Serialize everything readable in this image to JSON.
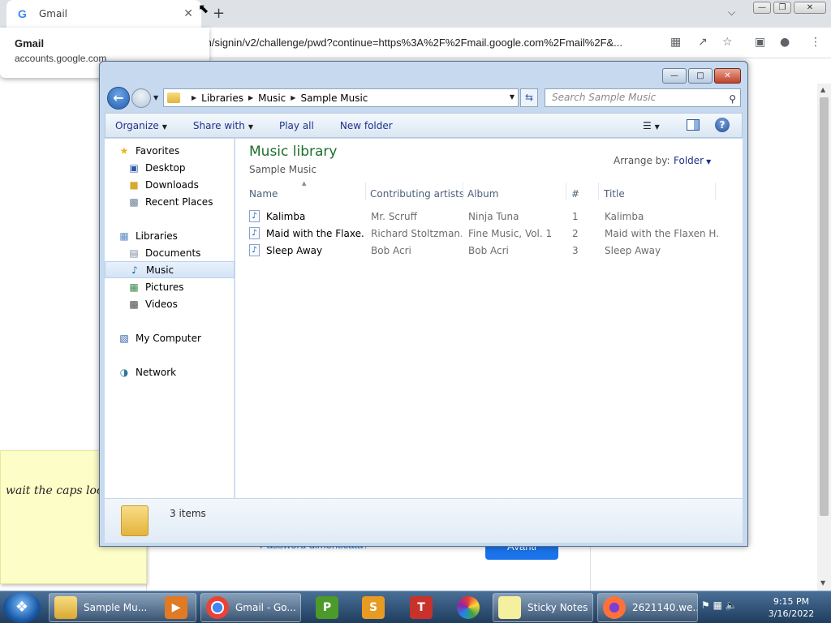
{
  "chrome": {
    "tab_title": "Gmail",
    "tab_icon": "G",
    "close_glyph": "✕",
    "new_tab_glyph": "+",
    "address": "m/signin/v2/challenge/pwd?continue=https%3A%2F%2Fmail.google.com%2Fmail%2F&...",
    "hover_card": {
      "title": "Gmail",
      "url": "accounts.google.com"
    },
    "page": {
      "forgot_link": "Password dimenticata?",
      "next_button": "Avanti"
    }
  },
  "sticky": {
    "text": "wait the caps lock fixed itself"
  },
  "explorer": {
    "breadcrumbs": [
      "Libraries",
      "Music",
      "Sample Music"
    ],
    "search_placeholder": "Search Sample Music",
    "commands": [
      "Organize",
      "Share with",
      "Play all",
      "New folder"
    ],
    "nav": {
      "favorites": "Favorites",
      "desktop": "Desktop",
      "downloads": "Downloads",
      "recent": "Recent Places",
      "libraries": "Libraries",
      "documents": "Documents",
      "music": "Music",
      "pictures": "Pictures",
      "videos": "Videos",
      "computer": "My Computer",
      "network": "Network"
    },
    "library_title": "Music library",
    "library_sub": "Sample Music",
    "arrange_label": "Arrange by:",
    "arrange_value": "Folder",
    "columns": [
      "Name",
      "Contributing artists",
      "Album",
      "#",
      "Title"
    ],
    "rows": [
      [
        "Kalimba",
        "Mr. Scruff",
        "Ninja Tuna",
        "1",
        "Kalimba"
      ],
      [
        "Maid with the Flaxe...",
        "Richard Stoltzman...",
        "Fine Music, Vol. 1",
        "2",
        "Maid with the Flaxen H..."
      ],
      [
        "Sleep Away",
        "Bob Acri",
        "Bob Acri",
        "3",
        "Sleep Away"
      ]
    ],
    "item_count": "3 items"
  },
  "taskbar": {
    "explorer_btn": "Sample Mu...",
    "chrome_btn": "Gmail - Go...",
    "sticky_btn": "Sticky Notes",
    "firefox_btn": "2621140.we...",
    "time": "9:15 PM",
    "date": "3/16/2022"
  }
}
